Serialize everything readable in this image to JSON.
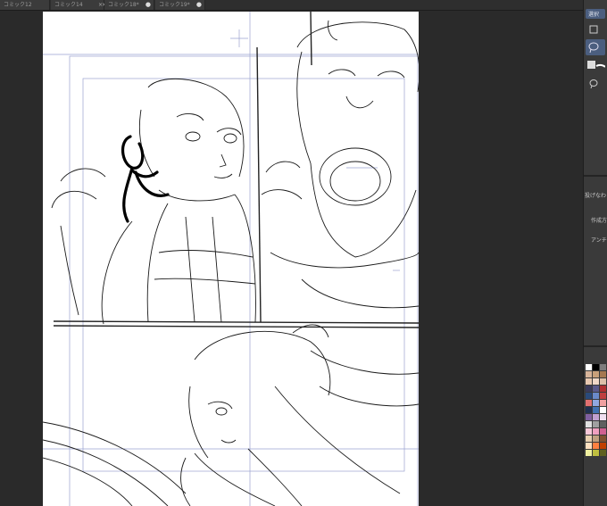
{
  "tabs": [
    {
      "label": "コミック12",
      "active": false,
      "close": "×"
    },
    {
      "label": "コミック14",
      "active": false,
      "close": "×"
    },
    {
      "label": "コミック18*",
      "active": true,
      "close": "●"
    },
    {
      "label": "コミック19*",
      "active": false,
      "close": "●"
    }
  ],
  "right_panel": {
    "selection_label": "選択",
    "layer_panel_title": "投げなわ",
    "create_label": "作成方",
    "antialias_label": "アンチ",
    "colors": [
      "#ffffff",
      "#000000",
      "#7d7d7d",
      "#d7b49a",
      "#c8a07a",
      "#a57850",
      "#e8c8b0",
      "#f0d8c8",
      "#dcc0a8",
      "#3a3a5a",
      "#5a5a8a",
      "#b03030",
      "#2a4a7a",
      "#6a8ac8",
      "#c04040",
      "#e07070",
      "#90a8e0",
      "#f0a0a0",
      "#203050",
      "#4070b0",
      "#ffffff",
      "#8060a0",
      "#c0a0d0",
      "#f0e0f0",
      "#e0e0e0",
      "#a0a0a0",
      "#606060",
      "#f8c8d8",
      "#f0a0c0",
      "#d06090",
      "#e8d0b0",
      "#c0a080",
      "#805030",
      "#ffe0c0",
      "#ff8040",
      "#c04000",
      "#f0f0a0",
      "#c0c040",
      "#606020"
    ]
  }
}
